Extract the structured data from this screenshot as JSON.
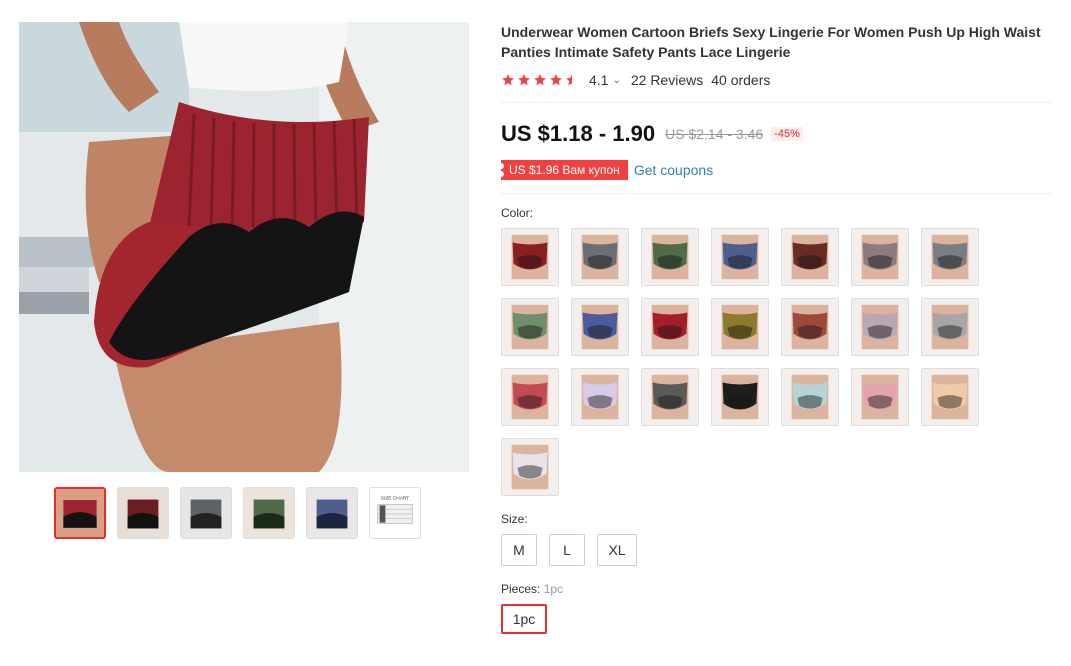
{
  "product": {
    "title": "Underwear Women Cartoon Briefs Sexy Lingerie For Women Push Up High Waist Panties Intimate Safety Pants Lace Lingerie",
    "rating": "4.1",
    "rating_chevron": "⌄",
    "reviews": "22 Reviews",
    "orders": "40 orders",
    "price": "US $1.18 - 1.90",
    "old_price": "US $2.14 - 3.46",
    "discount": "-45%",
    "coupon": "US $1.96 Вам купон",
    "get_coupons": "Get coupons"
  },
  "gallery": {
    "thumbnails": [
      "red",
      "darkred",
      "gray",
      "green",
      "blue",
      "size-chart"
    ],
    "size_chart_label": "SIZE CHART"
  },
  "options": {
    "color_label": "Color:",
    "colors": [
      "#8a1e25",
      "#6e6e72",
      "#4f6b49",
      "#4e5f8f",
      "#6a2a25",
      "#8c7b80",
      "#7b7d82",
      "#6f8f6c",
      "#4d5b9c",
      "#a3202a",
      "#8c7a2d",
      "#9b4a3c",
      "#b9a8b4",
      "#a6a6a8",
      "#c44a55",
      "#d6cbe8",
      "#5a5a5a",
      "#1e1e1e",
      "#b7d3d6",
      "#e3a5ad",
      "#f0c9a8",
      "#e8e4ea"
    ],
    "size_label": "Size:",
    "sizes": [
      "M",
      "L",
      "XL"
    ],
    "pieces_label": "Pieces:",
    "pieces_selected": "1pc",
    "pieces": [
      "1pc"
    ]
  },
  "colors": {
    "accent": "#e62e2e",
    "star": "#f04040",
    "link": "#2f7fb5"
  },
  "icons": {
    "star": "star-icon",
    "chevron": "chevron-down-icon"
  }
}
